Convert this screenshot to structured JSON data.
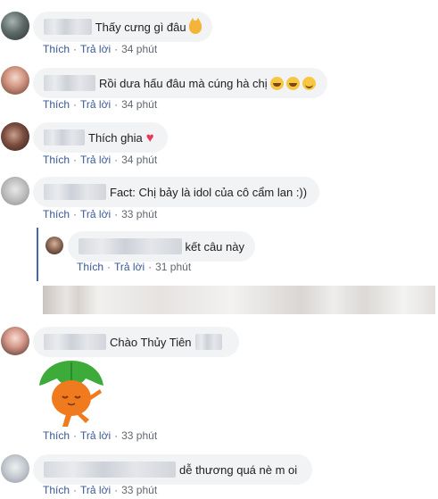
{
  "actions": {
    "like": "Thích",
    "reply": "Trả lời",
    "separator": "·"
  },
  "comments": [
    {
      "text": "Thấy cưng gì đâu",
      "time": "34 phút",
      "emojis": [
        "cat-face-icon"
      ]
    },
    {
      "text": "Rồi dưa hấu đâu mà cúng hà chị",
      "time": "34 phút",
      "emojis": [
        "rofl-icon",
        "rofl-icon",
        "grin-icon"
      ]
    },
    {
      "text": "Thích ghia",
      "time": "34 phút",
      "emojis": [
        "heart-icon"
      ]
    },
    {
      "text": "Fact: Chị bảy là idol của cô cẩm lan :))",
      "time": "33 phút"
    },
    {
      "text": "kết câu này",
      "time": "31 phút",
      "is_reply": true
    },
    {
      "text": "Chào Thủy Tiên",
      "time": "33 phút",
      "sticker": "orange-leaf-sticker"
    },
    {
      "text": "dễ thương quá nè m oi",
      "time": "33 phút"
    }
  ],
  "colors": {
    "link": "#385898",
    "bubble": "#f2f3f5",
    "reply_bar": "#4267b2",
    "heart": "#e8395c"
  }
}
